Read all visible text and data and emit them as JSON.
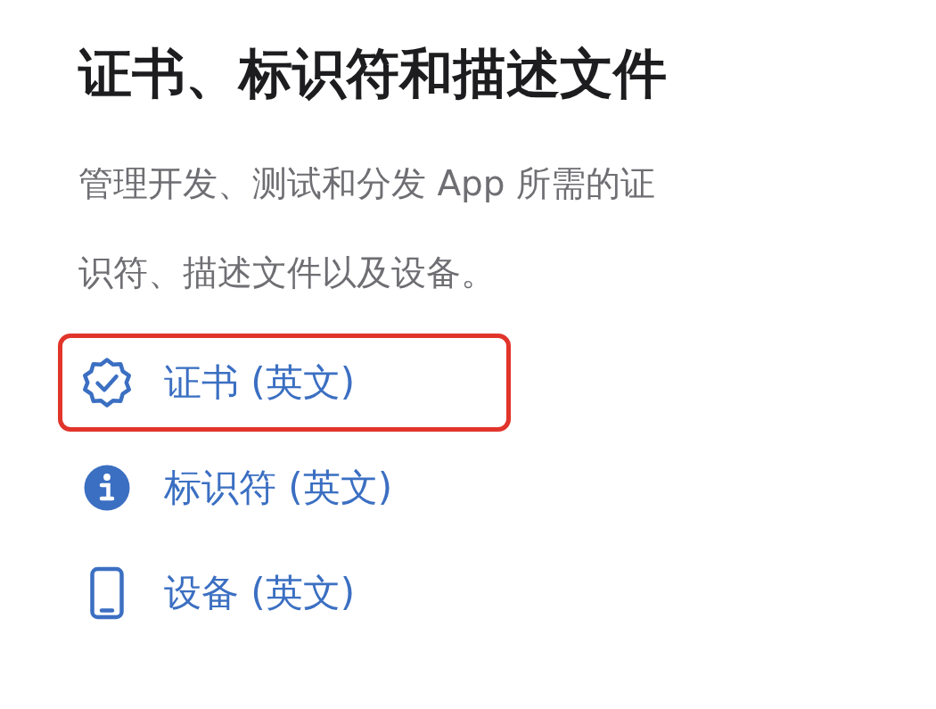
{
  "title": "证书、标识符和描述文件",
  "description_lines": [
    "管理开发、测试和分发 App 所需的证",
    "识符、描述文件以及设备。"
  ],
  "links": [
    {
      "kind": "certificate",
      "label": "证书 (英文)",
      "selected": true
    },
    {
      "kind": "identifier",
      "label": "标识符 (英文)",
      "selected": false
    },
    {
      "kind": "device",
      "label": "设备 (英文)",
      "selected": false
    }
  ]
}
